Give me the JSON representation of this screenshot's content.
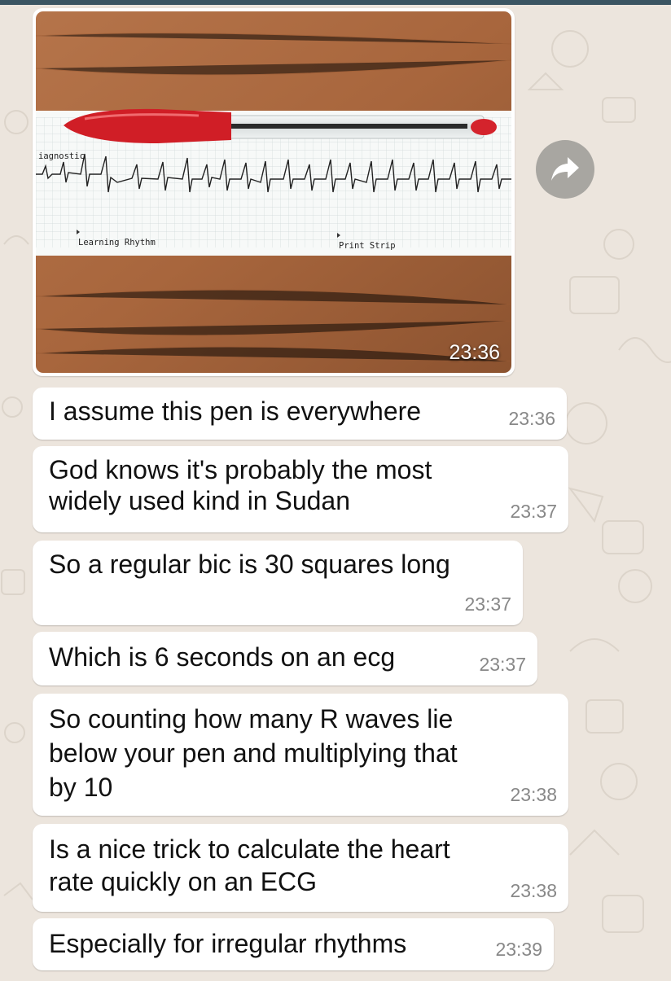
{
  "image_message": {
    "time": "23:36",
    "strip_left_label": "Learning Rhythm",
    "strip_right_label": "Print Strip",
    "strip_top_label": "iagnostic"
  },
  "forward_icon": "forward-arrow",
  "messages": [
    {
      "text": "I assume this pen is everywhere",
      "time": "23:36"
    },
    {
      "lines": [
        "God knows it's probably the most",
        "widely used kind in Sudan"
      ],
      "time": "23:37"
    },
    {
      "text": "So a regular bic is 30 squares long",
      "time": "23:37"
    },
    {
      "text": "Which is 6 seconds on an ecg",
      "time": "23:37"
    },
    {
      "lines": [
        "So counting how many R waves lie",
        "below your pen and multiplying that",
        "by 10"
      ],
      "time": "23:38"
    },
    {
      "lines": [
        "Is a nice trick to calculate the heart",
        "rate quickly on an ECG"
      ],
      "time": "23:38"
    },
    {
      "text": "Especially for irregular rhythms",
      "time": "23:39"
    }
  ],
  "colors": {
    "background": "#ece5dd",
    "bubble": "#ffffff",
    "timestamp": "#888888"
  }
}
